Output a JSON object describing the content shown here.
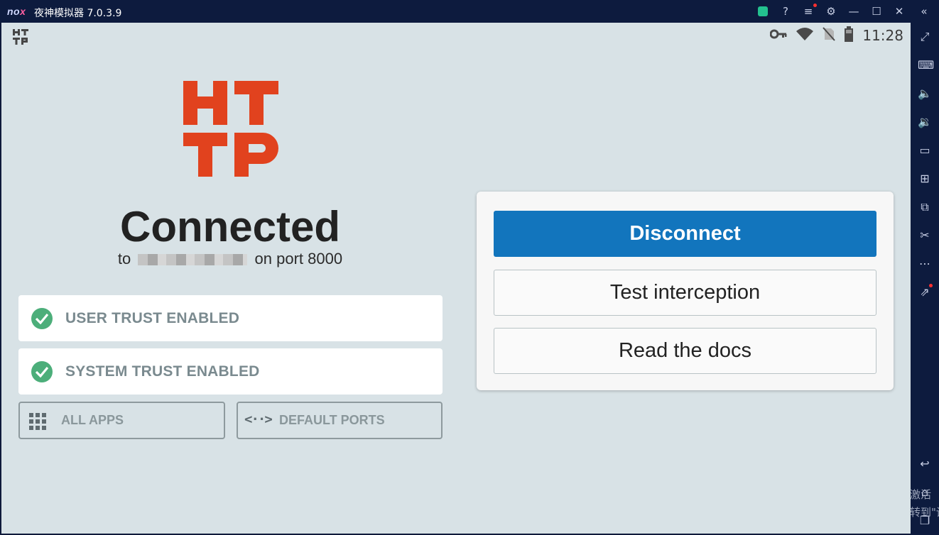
{
  "titlebar": {
    "logo_prefix": "no",
    "logo_suffix": "x",
    "title": "夜神模拟器 7.0.3.9"
  },
  "status_bar": {
    "app_icon_text": "HTTP",
    "time": "11:28"
  },
  "main": {
    "logo_letters": "HTTP",
    "logo_color": "#e1421e",
    "connected_title": "Connected",
    "connected_prefix": "to",
    "connected_suffix": "on port 8000",
    "trust": [
      {
        "label": "USER TRUST ENABLED"
      },
      {
        "label": "SYSTEM TRUST ENABLED"
      }
    ],
    "options": [
      {
        "label": "ALL APPS",
        "icon": "grid-icon"
      },
      {
        "label": "DEFAULT PORTS",
        "icon": "code-icon"
      }
    ]
  },
  "panel": {
    "disconnect": "Disconnect",
    "test": "Test interception",
    "docs": "Read the docs"
  },
  "colors": {
    "primary": "#1275bd",
    "check": "#4cae7a",
    "screen_bg": "#d8e2e6"
  },
  "watermark": {
    "line1": "激活",
    "line2": "转到\"设"
  }
}
